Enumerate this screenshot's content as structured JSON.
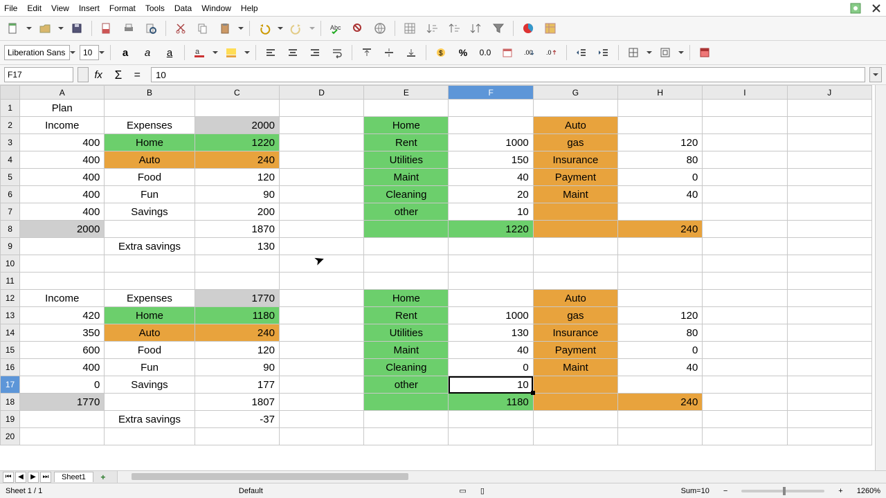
{
  "menu": {
    "file": "File",
    "edit": "Edit",
    "view": "View",
    "insert": "Insert",
    "format": "Format",
    "tools": "Tools",
    "data": "Data",
    "window": "Window",
    "help": "Help"
  },
  "font": {
    "name": "Liberation Sans",
    "size": "10"
  },
  "formula_bar": {
    "cellref": "F17",
    "content": "10"
  },
  "columns": [
    "A",
    "B",
    "C",
    "D",
    "E",
    "F",
    "G",
    "H",
    "I",
    "J"
  ],
  "selected_column": "F",
  "selected_row": 17,
  "rows": [
    {
      "n": 1,
      "cells": {
        "A": {
          "t": "Plan",
          "a": "c"
        }
      }
    },
    {
      "n": 2,
      "cells": {
        "A": {
          "t": "Income",
          "a": "c"
        },
        "B": {
          "t": "Expenses",
          "a": "c"
        },
        "C": {
          "t": "2000",
          "a": "r",
          "bg": "hdr"
        },
        "E": {
          "t": "Home",
          "a": "c",
          "bg": "green"
        },
        "G": {
          "t": "Auto",
          "a": "c",
          "bg": "orange"
        }
      }
    },
    {
      "n": 3,
      "cells": {
        "A": {
          "t": "400",
          "a": "r"
        },
        "B": {
          "t": "Home",
          "a": "c",
          "bg": "green"
        },
        "C": {
          "t": "1220",
          "a": "r",
          "bg": "green"
        },
        "E": {
          "t": "Rent",
          "a": "c",
          "bg": "green"
        },
        "F": {
          "t": "1000",
          "a": "r"
        },
        "G": {
          "t": "gas",
          "a": "c",
          "bg": "orange"
        },
        "H": {
          "t": "120",
          "a": "r"
        }
      }
    },
    {
      "n": 4,
      "cells": {
        "A": {
          "t": "400",
          "a": "r"
        },
        "B": {
          "t": "Auto",
          "a": "c",
          "bg": "orange"
        },
        "C": {
          "t": "240",
          "a": "r",
          "bg": "orange"
        },
        "E": {
          "t": "Utilities",
          "a": "c",
          "bg": "green"
        },
        "F": {
          "t": "150",
          "a": "r"
        },
        "G": {
          "t": "Insurance",
          "a": "c",
          "bg": "orange"
        },
        "H": {
          "t": "80",
          "a": "r"
        }
      }
    },
    {
      "n": 5,
      "cells": {
        "A": {
          "t": "400",
          "a": "r"
        },
        "B": {
          "t": "Food",
          "a": "c"
        },
        "C": {
          "t": "120",
          "a": "r"
        },
        "E": {
          "t": "Maint",
          "a": "c",
          "bg": "green"
        },
        "F": {
          "t": "40",
          "a": "r"
        },
        "G": {
          "t": "Payment",
          "a": "c",
          "bg": "orange"
        },
        "H": {
          "t": "0",
          "a": "r"
        }
      }
    },
    {
      "n": 6,
      "cells": {
        "A": {
          "t": "400",
          "a": "r"
        },
        "B": {
          "t": "Fun",
          "a": "c"
        },
        "C": {
          "t": "90",
          "a": "r"
        },
        "E": {
          "t": "Cleaning",
          "a": "c",
          "bg": "green"
        },
        "F": {
          "t": "20",
          "a": "r"
        },
        "G": {
          "t": "Maint",
          "a": "c",
          "bg": "orange"
        },
        "H": {
          "t": "40",
          "a": "r"
        }
      }
    },
    {
      "n": 7,
      "cells": {
        "A": {
          "t": "400",
          "a": "r"
        },
        "B": {
          "t": "Savings",
          "a": "c"
        },
        "C": {
          "t": "200",
          "a": "r"
        },
        "E": {
          "t": "other",
          "a": "c",
          "bg": "green"
        },
        "F": {
          "t": "10",
          "a": "r"
        },
        "G": {
          "t": "",
          "bg": "orange"
        }
      }
    },
    {
      "n": 8,
      "cells": {
        "A": {
          "t": "2000",
          "a": "r",
          "bg": "hdr"
        },
        "C": {
          "t": "1870",
          "a": "r"
        },
        "E": {
          "t": "",
          "bg": "green"
        },
        "F": {
          "t": "1220",
          "a": "r",
          "bg": "green"
        },
        "G": {
          "t": "",
          "bg": "orange"
        },
        "H": {
          "t": "240",
          "a": "r",
          "bg": "orange"
        }
      }
    },
    {
      "n": 9,
      "cells": {
        "B": {
          "t": "Extra savings",
          "a": "c"
        },
        "C": {
          "t": "130",
          "a": "r"
        }
      }
    },
    {
      "n": 10,
      "cells": {}
    },
    {
      "n": 11,
      "cells": {}
    },
    {
      "n": 12,
      "cells": {
        "A": {
          "t": "Income",
          "a": "c"
        },
        "B": {
          "t": "Expenses",
          "a": "c"
        },
        "C": {
          "t": "1770",
          "a": "r",
          "bg": "hdr"
        },
        "E": {
          "t": "Home",
          "a": "c",
          "bg": "green"
        },
        "G": {
          "t": "Auto",
          "a": "c",
          "bg": "orange"
        }
      }
    },
    {
      "n": 13,
      "cells": {
        "A": {
          "t": "420",
          "a": "r"
        },
        "B": {
          "t": "Home",
          "a": "c",
          "bg": "green"
        },
        "C": {
          "t": "1180",
          "a": "r",
          "bg": "green"
        },
        "E": {
          "t": "Rent",
          "a": "c",
          "bg": "green"
        },
        "F": {
          "t": "1000",
          "a": "r"
        },
        "G": {
          "t": "gas",
          "a": "c",
          "bg": "orange"
        },
        "H": {
          "t": "120",
          "a": "r"
        }
      }
    },
    {
      "n": 14,
      "cells": {
        "A": {
          "t": "350",
          "a": "r"
        },
        "B": {
          "t": "Auto",
          "a": "c",
          "bg": "orange"
        },
        "C": {
          "t": "240",
          "a": "r",
          "bg": "orange"
        },
        "E": {
          "t": "Utilities",
          "a": "c",
          "bg": "green"
        },
        "F": {
          "t": "130",
          "a": "r"
        },
        "G": {
          "t": "Insurance",
          "a": "c",
          "bg": "orange"
        },
        "H": {
          "t": "80",
          "a": "r"
        }
      }
    },
    {
      "n": 15,
      "cells": {
        "A": {
          "t": "600",
          "a": "r"
        },
        "B": {
          "t": "Food",
          "a": "c"
        },
        "C": {
          "t": "120",
          "a": "r"
        },
        "E": {
          "t": "Maint",
          "a": "c",
          "bg": "green"
        },
        "F": {
          "t": "40",
          "a": "r"
        },
        "G": {
          "t": "Payment",
          "a": "c",
          "bg": "orange"
        },
        "H": {
          "t": "0",
          "a": "r"
        }
      }
    },
    {
      "n": 16,
      "cells": {
        "A": {
          "t": "400",
          "a": "r"
        },
        "B": {
          "t": "Fun",
          "a": "c"
        },
        "C": {
          "t": "90",
          "a": "r"
        },
        "E": {
          "t": "Cleaning",
          "a": "c",
          "bg": "green"
        },
        "F": {
          "t": "0",
          "a": "r"
        },
        "G": {
          "t": "Maint",
          "a": "c",
          "bg": "orange"
        },
        "H": {
          "t": "40",
          "a": "r"
        }
      }
    },
    {
      "n": 17,
      "cells": {
        "A": {
          "t": "0",
          "a": "r"
        },
        "B": {
          "t": "Savings",
          "a": "c"
        },
        "C": {
          "t": "177",
          "a": "r"
        },
        "E": {
          "t": "other",
          "a": "c",
          "bg": "green"
        },
        "F": {
          "t": "10",
          "a": "r",
          "sel": true
        },
        "G": {
          "t": "",
          "bg": "orange"
        }
      }
    },
    {
      "n": 18,
      "cells": {
        "A": {
          "t": "1770",
          "a": "r",
          "bg": "hdr"
        },
        "C": {
          "t": "1807",
          "a": "r"
        },
        "E": {
          "t": "",
          "bg": "green"
        },
        "F": {
          "t": "1180",
          "a": "r",
          "bg": "green"
        },
        "G": {
          "t": "",
          "bg": "orange"
        },
        "H": {
          "t": "240",
          "a": "r",
          "bg": "orange"
        }
      }
    },
    {
      "n": 19,
      "cells": {
        "B": {
          "t": "Extra savings",
          "a": "c"
        },
        "C": {
          "t": "-37",
          "a": "r"
        }
      }
    },
    {
      "n": 20,
      "cells": {}
    }
  ],
  "sheet_tab": "Sheet1",
  "status": {
    "sheet": "Sheet 1 / 1",
    "style": "Default",
    "sum": "Sum=10",
    "zoom": "1260%"
  },
  "labels": {
    "percent": "%",
    "decimal": "0.0",
    "bold": "a",
    "italic": "a",
    "underline": "a"
  }
}
